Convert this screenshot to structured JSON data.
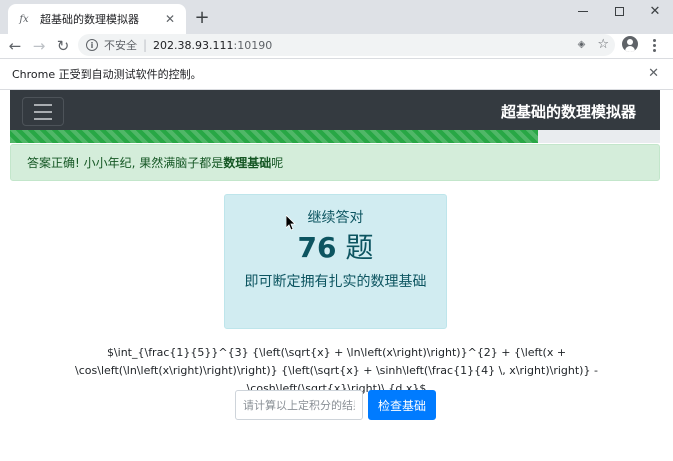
{
  "browser": {
    "tab": {
      "favicon": "f𝑥",
      "title": "超基础的数理模拟器",
      "close": "✕"
    },
    "new_tab": "+",
    "window_controls": {
      "minimize": "",
      "maximize": "",
      "close": "✕"
    },
    "toolbar": {
      "back": "←",
      "forward": "→",
      "reload": "↻",
      "security_label": "不安全",
      "separator": "|",
      "url_host": "202.38.93.111",
      "url_port": ":10190"
    },
    "infobar": {
      "text": "Chrome 正受到自动测试软件的控制。",
      "close": "✕"
    }
  },
  "page": {
    "navbar": {
      "brand": "超基础的数理模拟器"
    },
    "progress": {
      "fraction": 0.812
    },
    "alert": {
      "prefix": "答案正确! 小小年纪, 果然满脑子都是",
      "strong": "数理基础",
      "suffix": "呢"
    },
    "card": {
      "top": "继续答对",
      "count": "76",
      "unit": "题",
      "desc": "即可断定拥有扎实的数理基础"
    },
    "question": "$\\int_{\\frac{1}{5}}^{3} {\\left(\\sqrt{x} + \\ln\\left(x\\right)\\right)}^{2} + {\\left(x + \\cos\\left(\\ln\\left(x\\right)\\right)\\right)} {\\left(\\sqrt{x} + \\sinh\\left(\\frac{1}{4} \\, x\\right)\\right)} - \\cosh\\left(\\sqrt{x}\\right)\\,{d x}$",
    "answer": {
      "placeholder": "请计算以上定积分的结果",
      "value": "",
      "button_label": "检查基础"
    }
  }
}
